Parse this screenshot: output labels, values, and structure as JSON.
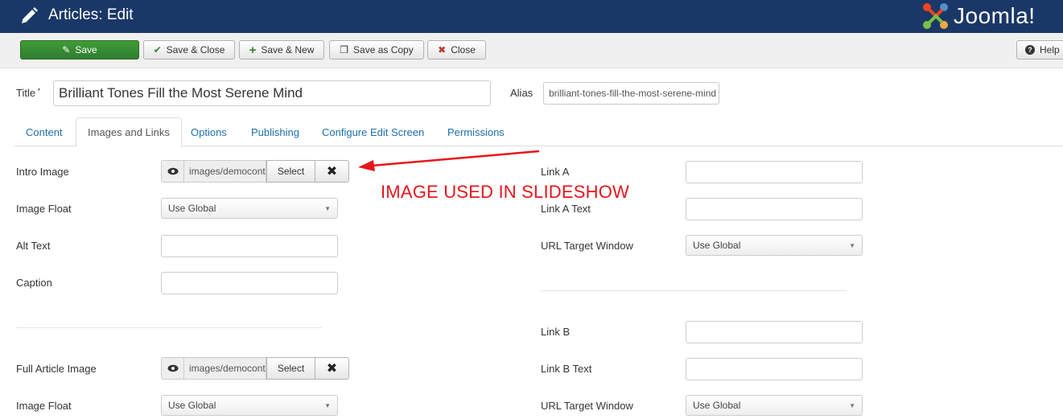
{
  "header": {
    "title": "Articles: Edit",
    "brand": "Joomla!"
  },
  "toolbar": {
    "save": "Save",
    "save_close": "Save & Close",
    "save_new": "Save & New",
    "save_copy": "Save as Copy",
    "close": "Close",
    "help": "Help"
  },
  "form": {
    "title_label": "Title",
    "required_mark": " *",
    "title_value": "Brilliant Tones Fill the Most Serene Mind",
    "alias_label": "Alias",
    "alias_value": "brilliant-tones-fill-the-most-serene-mind"
  },
  "tabs": [
    "Content",
    "Images and Links",
    "Options",
    "Publishing",
    "Configure Edit Screen",
    "Permissions"
  ],
  "images": {
    "intro_label": "Intro Image",
    "intro_path": "images/democontent/",
    "select_label": "Select",
    "float_label": "Image Float",
    "float_value": "Use Global",
    "alt_label": "Alt Text",
    "caption_label": "Caption",
    "full_label": "Full Article Image",
    "full_path": "images/democontent/",
    "full_float_label": "Image Float",
    "full_float_value": "Use Global"
  },
  "links": {
    "a_label": "Link A",
    "a_text_label": "Link A Text",
    "a_target_label": "URL Target Window",
    "a_target_value": "Use Global",
    "b_label": "Link B",
    "b_text_label": "Link B Text",
    "b_target_label": "URL Target Window",
    "b_target_value": "Use Global"
  },
  "annotation": {
    "text": "IMAGE USED IN SLIDESHOW",
    "color": "#e8151c"
  },
  "colors": {
    "header": "#1a3867",
    "save_button": "#378137",
    "tab_link": "#1f6fab"
  }
}
